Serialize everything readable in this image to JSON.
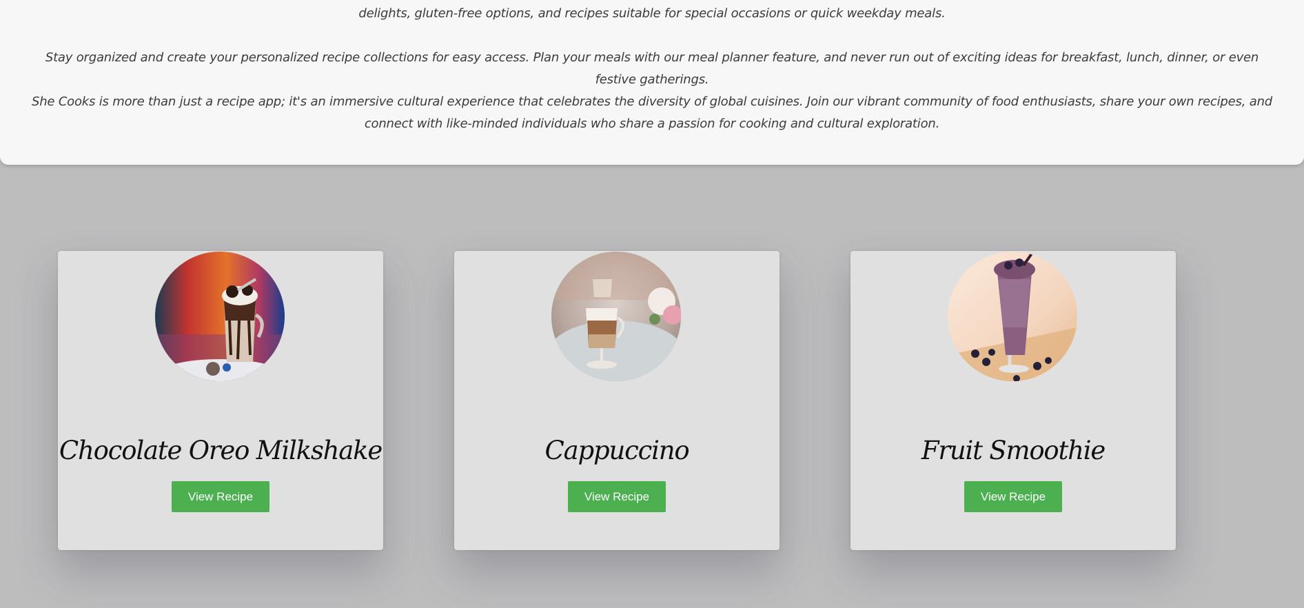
{
  "intro": {
    "paragraphs": [
      "delights, gluten-free options, and recipes suitable for special occasions or quick weekday meals.",
      "Stay organized and create your personalized recipe collections for easy access. Plan your meals with our meal planner feature, and never run out of exciting ideas for breakfast, lunch, dinner, or even festive gatherings.",
      "She Cooks is more than just a recipe app; it's an immersive cultural experience that celebrates the diversity of global cuisines. Join our vibrant community of food enthusiasts, share your own recipes, and connect with like-minded individuals who share a passion for cooking and cultural exploration."
    ]
  },
  "cards": [
    {
      "title": "Chocolate Oreo Milkshake",
      "button_label": "View Recipe",
      "image": "chocolate-milkshake-photo"
    },
    {
      "title": "Cappuccino",
      "button_label": "View Recipe",
      "image": "cappuccino-photo"
    },
    {
      "title": "Fruit Smoothie",
      "button_label": "View Recipe",
      "image": "fruit-smoothie-photo"
    }
  ],
  "colors": {
    "page_background": "#bdbdbe",
    "panel_background": "#f7f7f7",
    "card_background": "#e0e0e0",
    "button_background": "#4caf50",
    "button_text": "#ffffff"
  }
}
